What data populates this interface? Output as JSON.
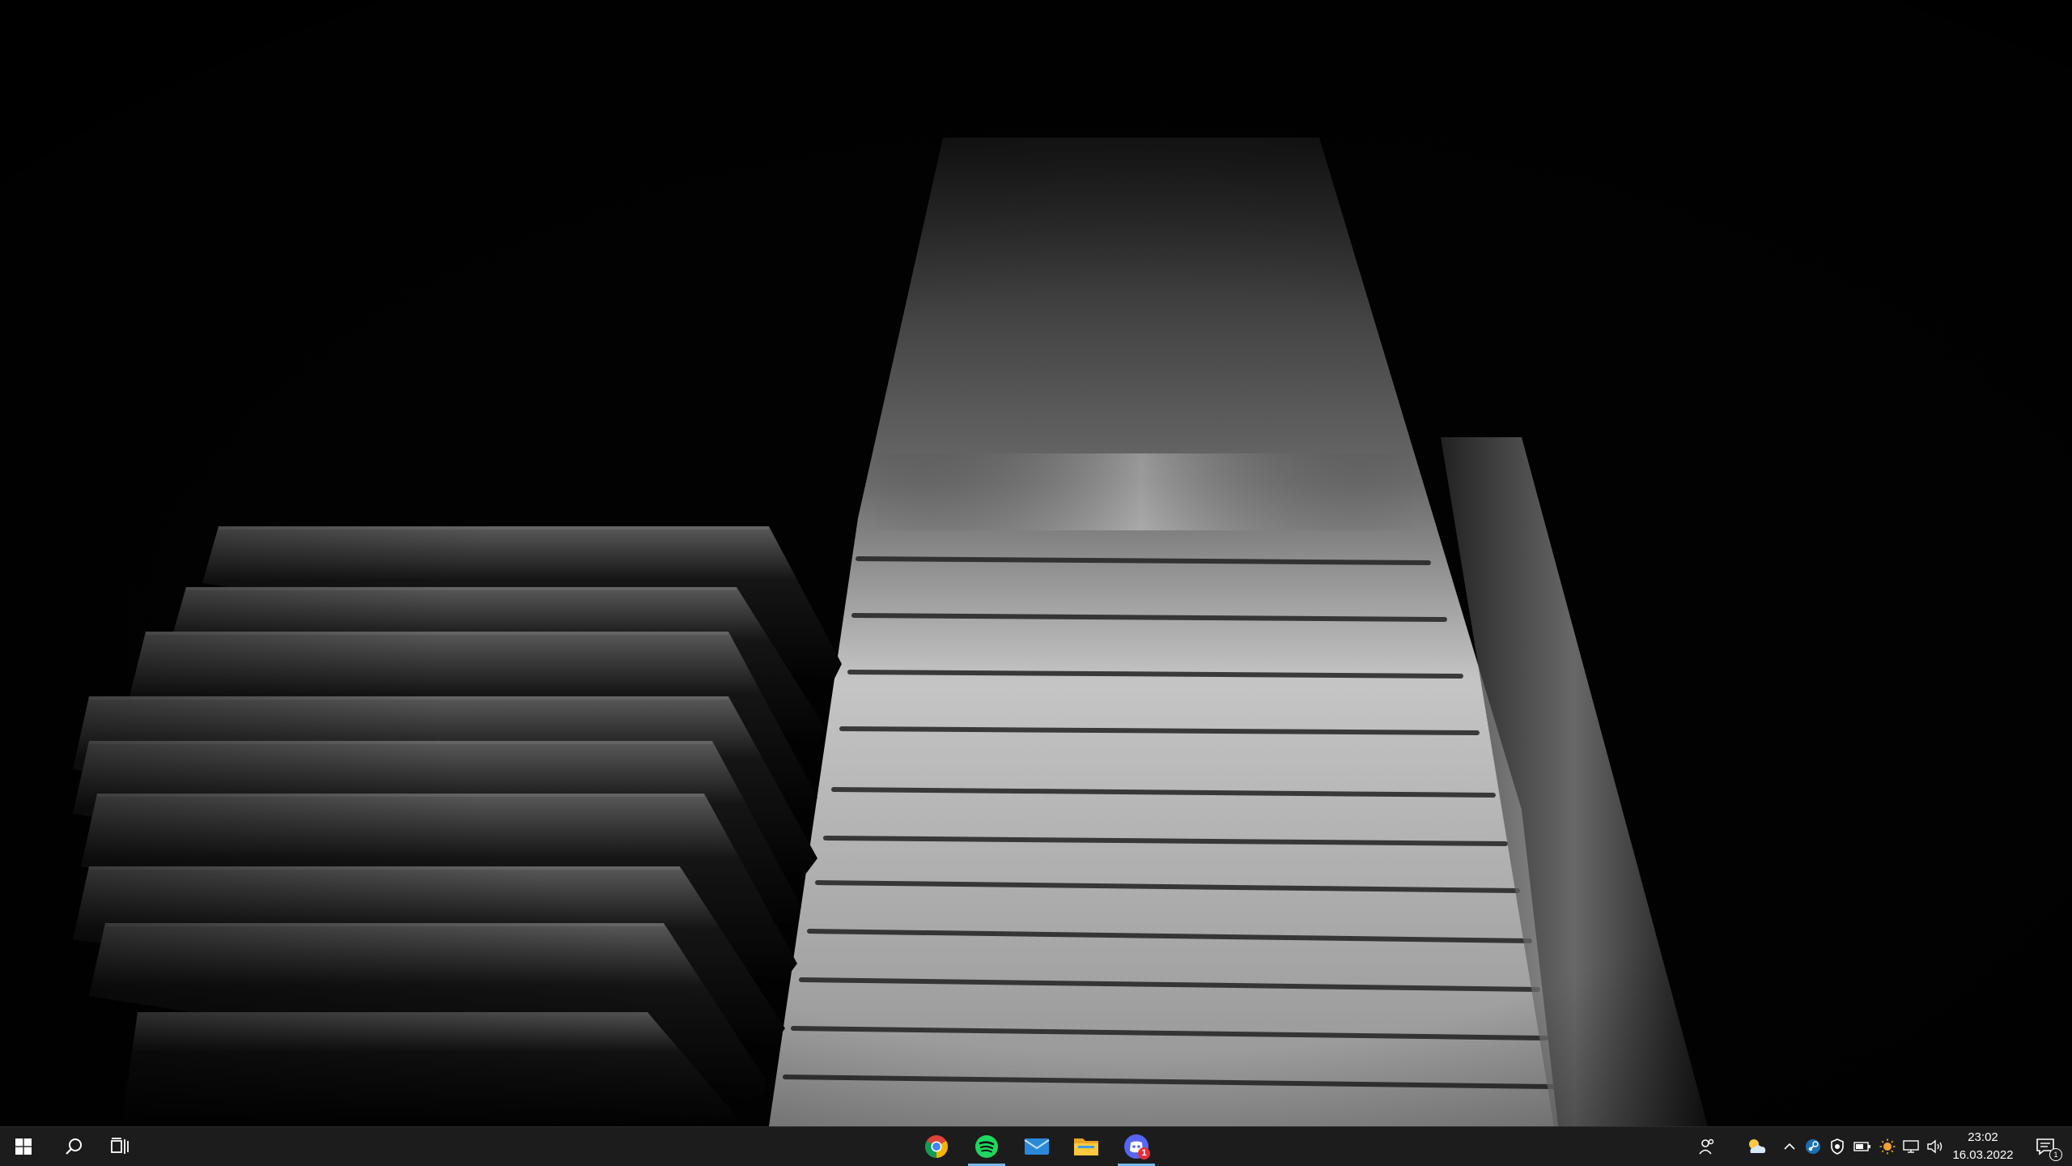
{
  "desktop": {
    "wallpaper_icon": "piano-keys-wallpaper"
  },
  "taskbar": {
    "start_icon": "windows-logo-icon",
    "search_icon": "search-icon",
    "task_view_icon": "task-view-icon",
    "pinned_apps": [
      {
        "name": "Google Chrome",
        "icon": "chrome-icon",
        "running": false
      },
      {
        "name": "Spotify",
        "icon": "spotify-icon",
        "running": true
      },
      {
        "name": "Mail",
        "icon": "mail-icon",
        "running": false
      },
      {
        "name": "File Explorer",
        "icon": "folder-icon",
        "running": false
      },
      {
        "name": "Discord",
        "icon": "discord-icon",
        "running": true,
        "badge": "1"
      }
    ],
    "tray": {
      "icons": [
        "people-icon",
        "weather-icon",
        "chevron-up-icon",
        "steam-icon",
        "shield-icon",
        "battery-icon",
        "sun-icon",
        "network-icon",
        "volume-icon"
      ],
      "time": "23:02",
      "date": "16.03.2022",
      "notification_count": "1"
    },
    "accent_color": "#76b9ed"
  }
}
